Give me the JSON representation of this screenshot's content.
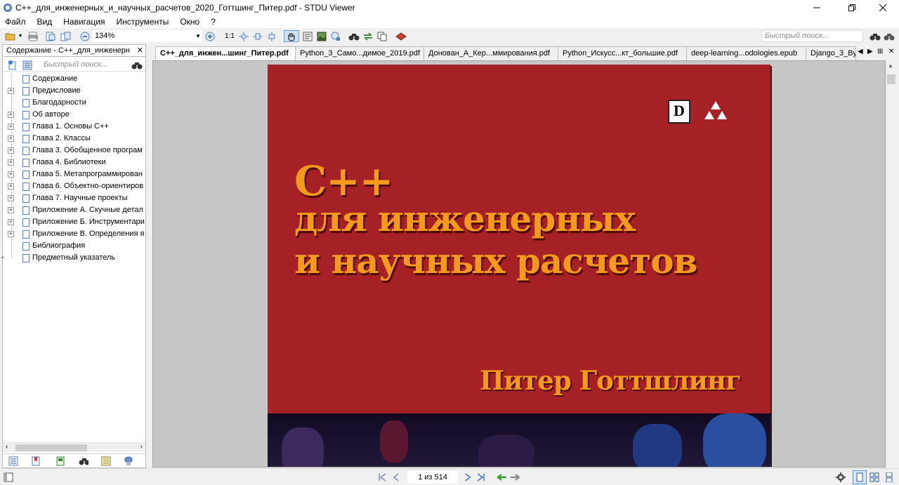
{
  "window": {
    "title": "C++_для_инженерных_и_научных_расчетов_2020_Готтшинг_Питер.pdf - STDU Viewer",
    "controls": [
      "minimize-icon",
      "restore-icon",
      "close-icon"
    ]
  },
  "menu": [
    "Файл",
    "Вид",
    "Навигация",
    "Инструменты",
    "Окно",
    "?"
  ],
  "toolbar": {
    "zoom": "134%",
    "fit_label": "1:1",
    "search_placeholder": "Быстрый поиск..."
  },
  "left_panel": {
    "tab_title": "Содержание - C++_для_инженерн",
    "tab_close": "✕",
    "search_placeholder": "Быстрый поиск...",
    "toc": [
      {
        "label": "Содержание",
        "expandable": false
      },
      {
        "label": "Предисловие",
        "expandable": true
      },
      {
        "label": "Благодарности",
        "expandable": false
      },
      {
        "label": "Об авторе",
        "expandable": true
      },
      {
        "label": "Глава 1. Основы C++",
        "expandable": true
      },
      {
        "label": "Глава 2. Классы",
        "expandable": true
      },
      {
        "label": "Глава 3. Обобщенное програм",
        "expandable": true
      },
      {
        "label": "Глава 4. Библиотеки",
        "expandable": true
      },
      {
        "label": "Глава 5. Метапрограммирован",
        "expandable": true
      },
      {
        "label": "Глава 6. Объектно-ориентиров",
        "expandable": true
      },
      {
        "label": "Глава 7. Научные проекты",
        "expandable": true
      },
      {
        "label": "Приложение А. Скучные детал",
        "expandable": true
      },
      {
        "label": "Приложение Б. Инструментари",
        "expandable": true
      },
      {
        "label": "Приложение В. Определения я",
        "expandable": true
      },
      {
        "label": "Библиография",
        "expandable": false
      },
      {
        "label": "Предметный указатель",
        "expandable": false
      }
    ]
  },
  "doc_tabs": [
    {
      "label": "C++_для_инжен...шинг_Питер.pdf",
      "active": true
    },
    {
      "label": "Python_3_Само...димое_2019.pdf",
      "active": false
    },
    {
      "label": "Донован_А_Кер...ммирования.pdf",
      "active": false
    },
    {
      "label": "Python_Искусс...кт_большие.pdf",
      "active": false
    },
    {
      "label": "deep-learning...odologies.epub",
      "active": false
    },
    {
      "label": "Django_3_By",
      "active": false
    }
  ],
  "cover": {
    "logo_letter": "D",
    "title_line1": "C++",
    "title_line2": "для инженерных",
    "title_line3": "и научных расчетов",
    "author": "Питер Готтшлинг",
    "colors": {
      "background": "#a52125",
      "title": "#f39a1e"
    }
  },
  "status": {
    "page_indicator": "1 из 514"
  }
}
